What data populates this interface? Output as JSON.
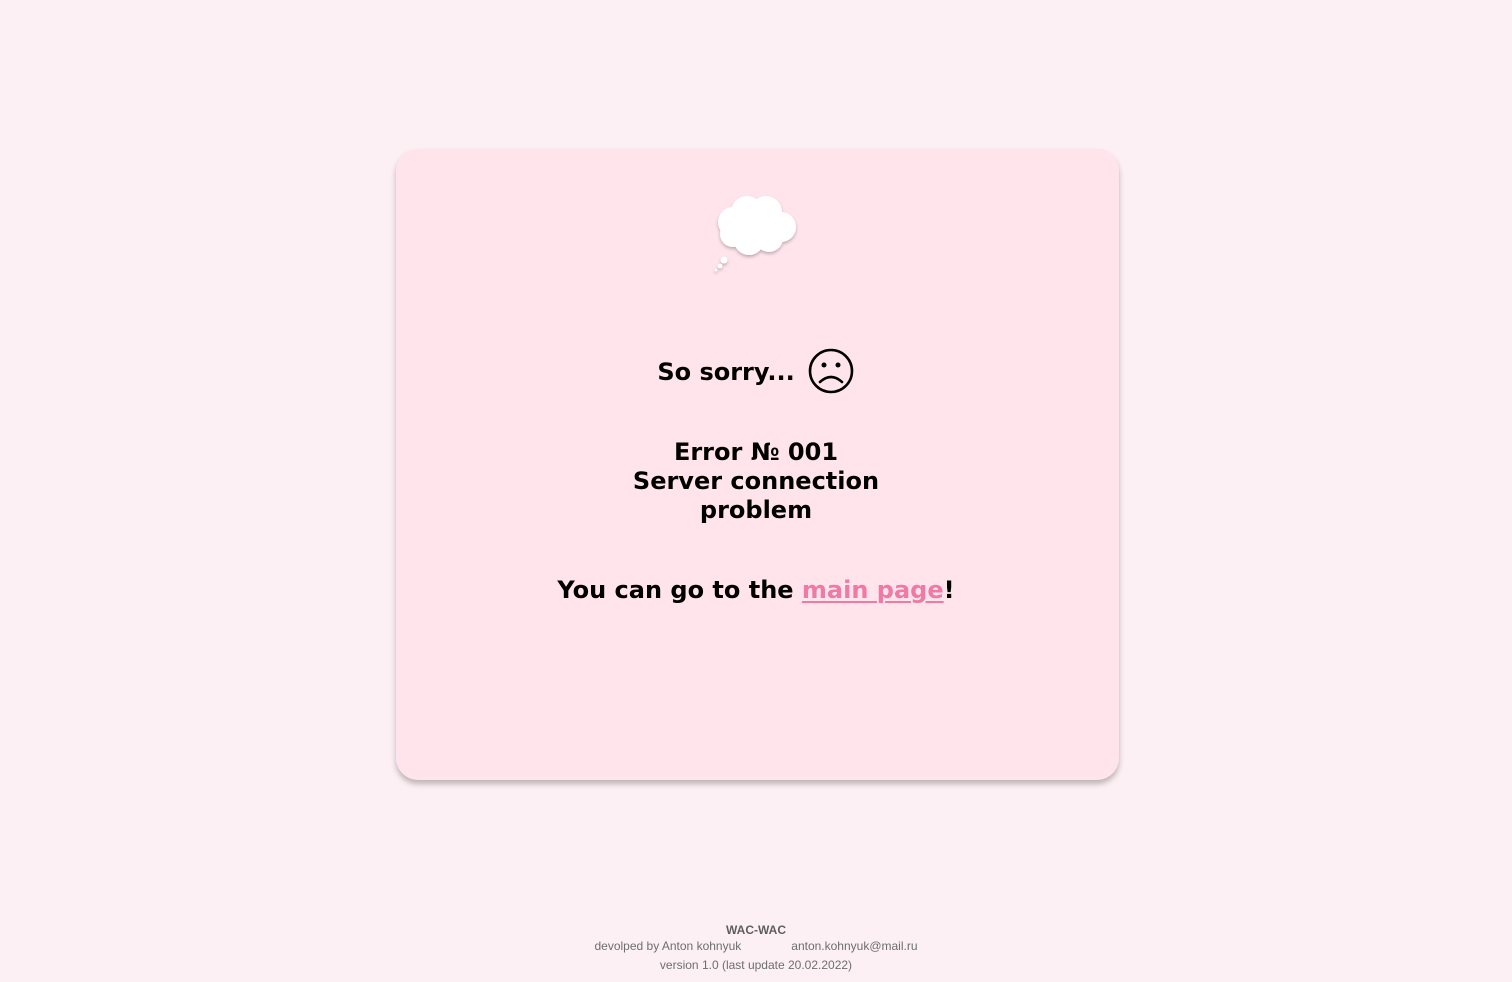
{
  "card": {
    "heading": "So sorry...",
    "error_number": "Error № 001",
    "error_line_1": "Server connection",
    "error_line_2": "problem",
    "goto_prefix": "You can go to the ",
    "goto_link": "main page",
    "goto_suffix": "!"
  },
  "icons": {
    "cloud": "thought-cloud-icon",
    "sad_face": "sad-face-icon"
  },
  "footer": {
    "brand": "WAC-WAC",
    "developer": "devolped by Anton kohnyuk",
    "email": "anton.kohnyuk@mail.ru",
    "version": "version 1.0 (last update 20.02.2022)"
  },
  "colors": {
    "page_background": "#fcf0f4",
    "card_background": "#ffe4ec",
    "link": "#ef7aa6",
    "text": "#000000",
    "footer_text": "#6e6e6e"
  }
}
